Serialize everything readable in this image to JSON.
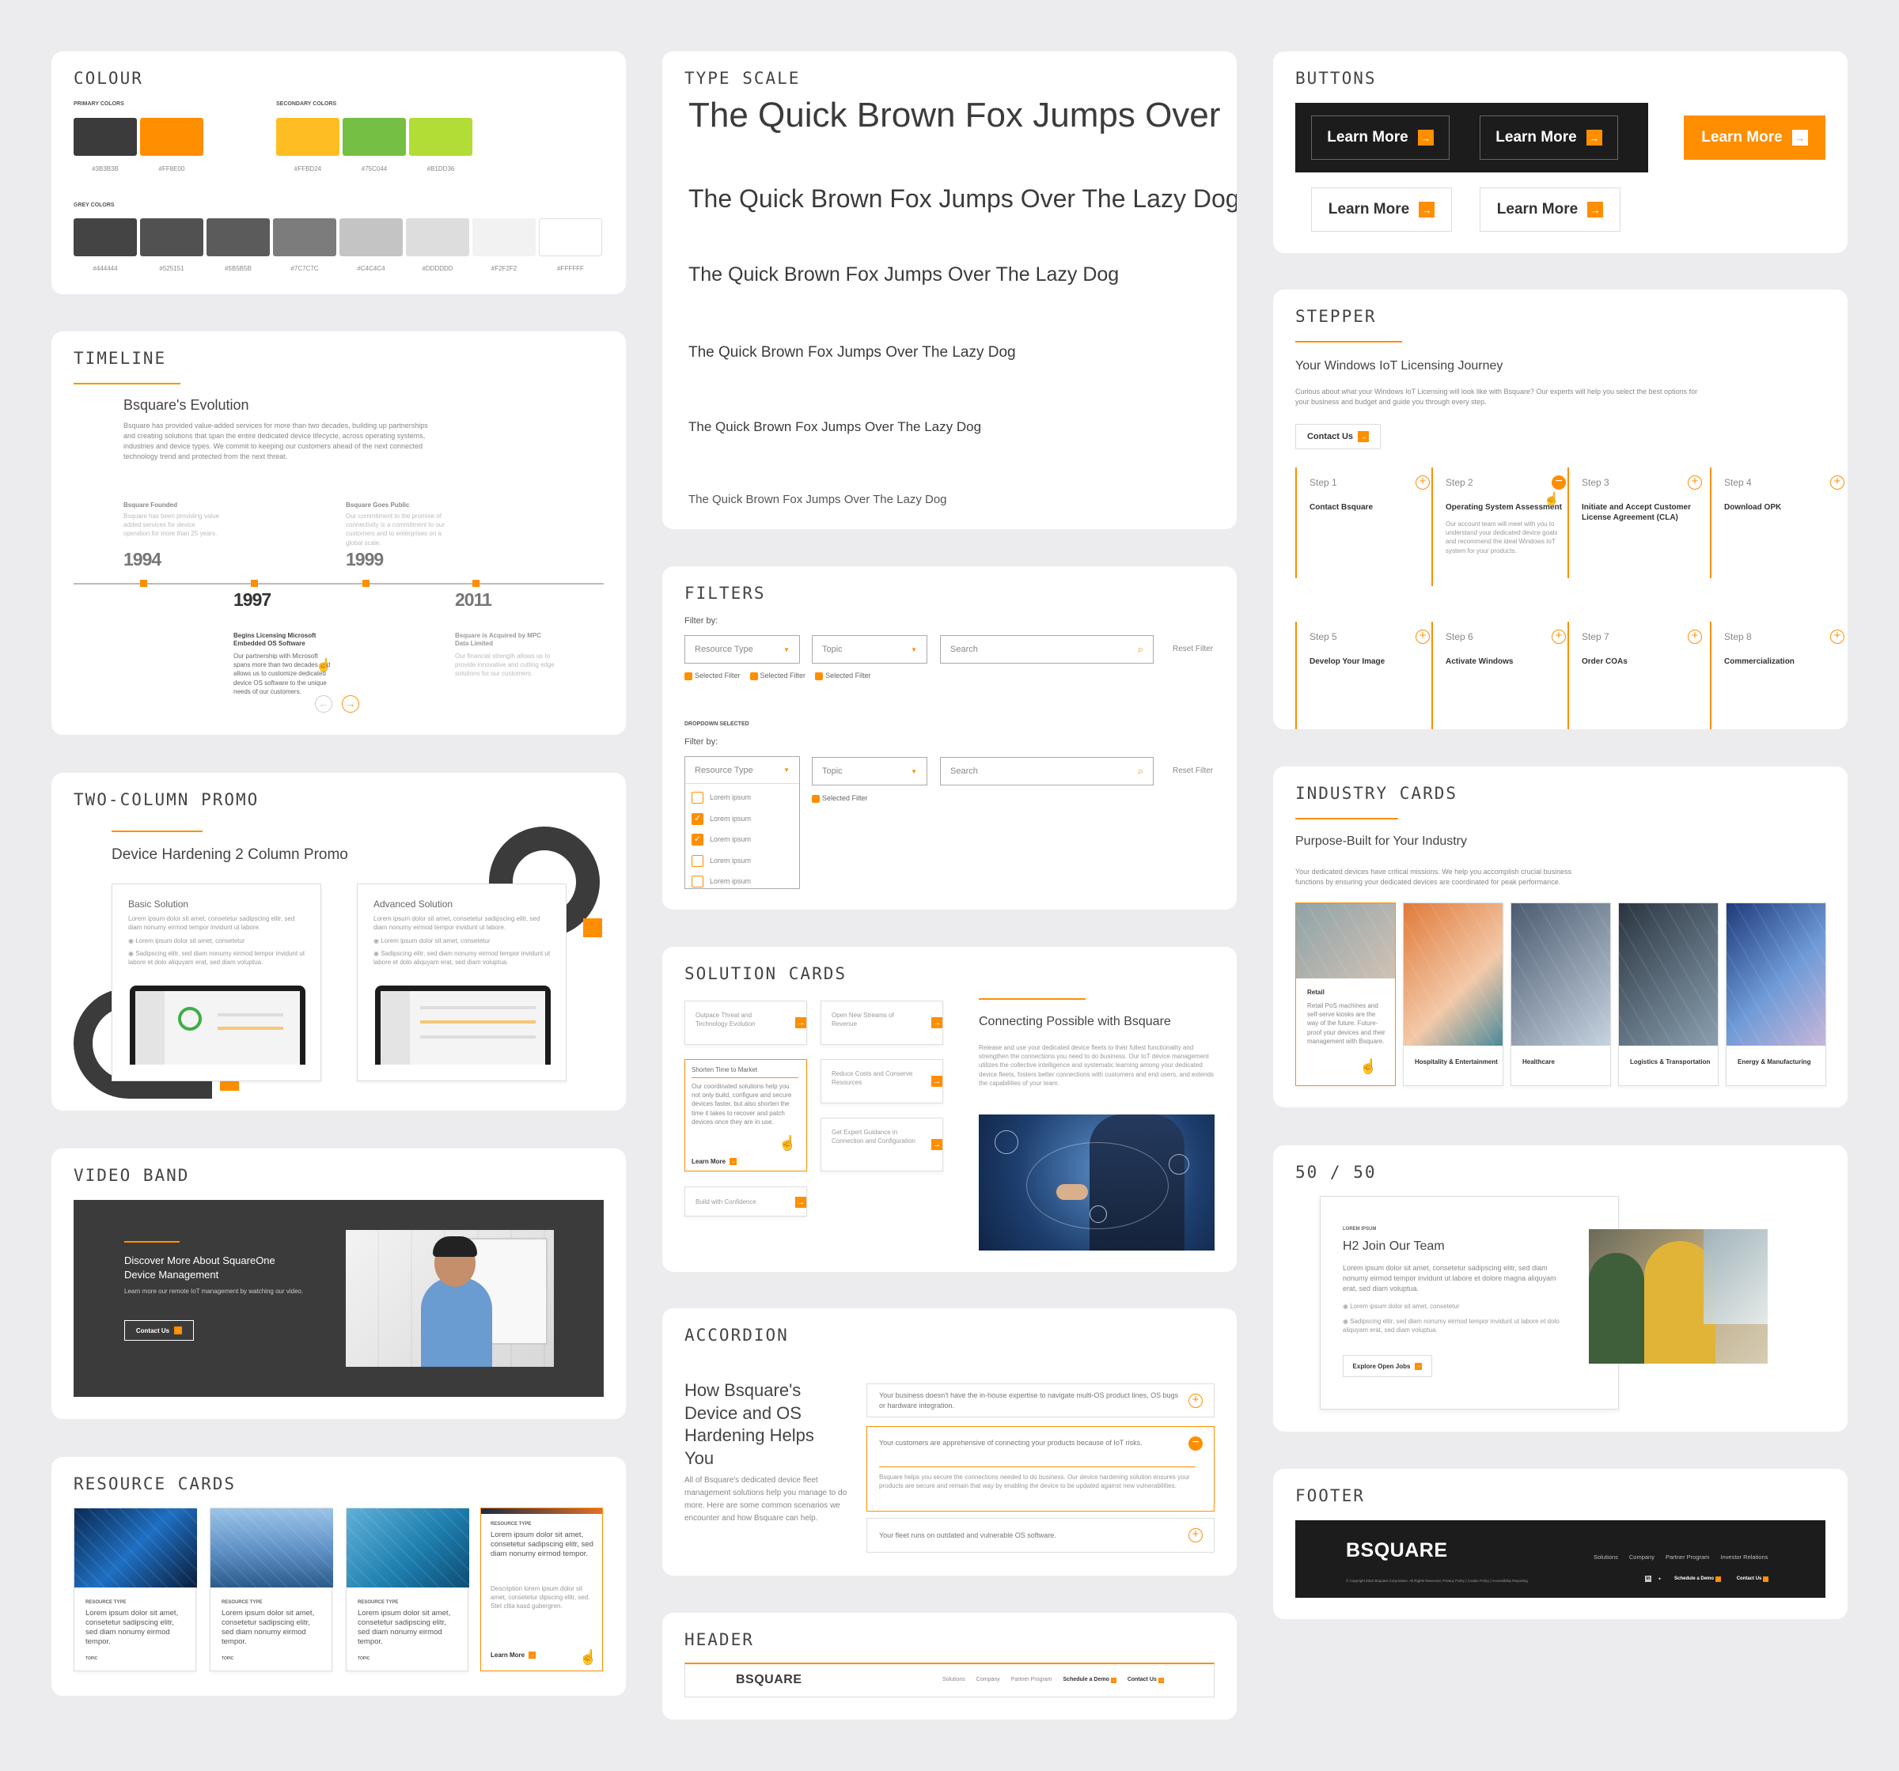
{
  "colour": {
    "title": "COLOUR",
    "primary_label": "PRIMARY COLORS",
    "secondary_label": "SECONDARY COLORS",
    "grey_label": "GREY COLORS",
    "primary": [
      {
        "hex": "#3B3B3B",
        "label": "#3B3B3B"
      },
      {
        "hex": "#FF8E00",
        "label": "#FF8E00"
      }
    ],
    "secondary": [
      {
        "hex": "#FFBD24",
        "label": "#FFBD24"
      },
      {
        "hex": "#75C044",
        "label": "#75C044"
      },
      {
        "hex": "#B1DD36",
        "label": "#B1DD36"
      }
    ],
    "grey": [
      {
        "hex": "#444444",
        "label": "#444444"
      },
      {
        "hex": "#525151",
        "label": "#525151"
      },
      {
        "hex": "#5B5B5B",
        "label": "#5B5B5B"
      },
      {
        "hex": "#7C7C7C",
        "label": "#7C7C7C"
      },
      {
        "hex": "#C4C4C4",
        "label": "#C4C4C4"
      },
      {
        "hex": "#DDDDDD",
        "label": "#DDDDDD"
      },
      {
        "hex": "#F2F2F2",
        "label": "#F2F2F2"
      },
      {
        "hex": "#FFFFFF",
        "label": "#FFFFFF"
      }
    ]
  },
  "timeline": {
    "title": "TIMELINE",
    "heading": "Bsquare's Evolution",
    "intro": "Bsquare has provided value-added services for more than two decades, building up partnerships and creating solutions that span the entire dedicated device lifecycle, across operating systems, industries and device types. We commit to keeping our customers ahead of the next connected technology trend and protected from the next threat.",
    "events": [
      {
        "year": "1994",
        "title": "Bsquare Founded",
        "text": "Bsquare has been providing value added services for device operation for more than 25 years."
      },
      {
        "year": "1997",
        "title": "Begins Licensing Microsoft Embedded OS Software",
        "text": "Our partnership with Microsoft spans more than two decades and allows us to customize dedicated device OS software to the unique needs of our customers."
      },
      {
        "year": "1999",
        "title": "Bsquare Goes Public",
        "text": "Our commitment to the promise of connectivity is a commitment to our customers and to enterprises on a global scale."
      },
      {
        "year": "2011",
        "title": "Bsquare is Acquired by MPC Data Limited",
        "text": "Our financial strength allows us to provide innovative and cutting edge solutions for our customers."
      }
    ]
  },
  "promo": {
    "title": "TWO-COLUMN PROMO",
    "heading": "Device Hardening 2 Column Promo",
    "cols": [
      {
        "name": "Basic Solution",
        "text": "Lorem ipsum dolor sit amet, consetetur sadipscing elitr, sed diam nonumy eirmod tempor invidunt ut labore.",
        "b1": "Lorem ipsum dolor sit amet, consetetur",
        "b2": "Sadipscing elitr, sed diam nonumy eirmod tempor invidunt ut labore et dolo aliquyam erat, sed diam voluptua."
      },
      {
        "name": "Advanced Solution",
        "text": "Lorem ipsum dolor sit amet, consetetur sadipscing elitr, sed diam nonumy eirmod tempor invidunt ut labore.",
        "b1": "Lorem ipsum dolor sit amet, consetetur",
        "b2": "Sadipscing elitr, sed diam nonumy eirmod tempor invidunt ut labore et dolo aliquyam erat, sed diam voluptua."
      }
    ]
  },
  "video": {
    "title": "VIDEO BAND",
    "heading": "Discover More About SquareOne Device Management",
    "text": "Learn more our remote IoT management by watching our video.",
    "cta": "Contact Us"
  },
  "resources": {
    "title": "RESOURCE CARDS",
    "type": "RESOURCE TYPE",
    "text": "Lorem ipsum dolor sit amet, consetetur sadipscing elitr, sed diam nonumy eirmod tempor.",
    "topic": "TOPIC",
    "hover_text": "Lorem ipsum dolor sit amet, consetetur sadipscing elitr, sed diam nonumy eirmod tempor.",
    "hover_desc": "Description lorem ipsum dolor sit amet, consetetur dipscing elitr, sed. Stet clita kasd gubergren.",
    "cta": "Learn More"
  },
  "type": {
    "title": "TYPE SCALE",
    "line1": "The Quick Brown Fox Jumps Over",
    "line": "The Quick Brown Fox Jumps Over The Lazy Dog"
  },
  "filters": {
    "title": "FILTERS",
    "filter_by": "Filter by:",
    "resource_type": "Resource Type",
    "topic": "Topic",
    "search": "Search",
    "reset": "Reset Filter",
    "selected": "Selected Filter",
    "dropdown_selected": "DROPDOWN SELECTED",
    "option": "Lorem ipsum"
  },
  "solutions": {
    "title": "SOLUTION CARDS",
    "left": [
      "Outpace Threat and Technology Evolution",
      "Shorten Time to Market",
      "Build with Confidence"
    ],
    "right": [
      "Open New Streams of Revenue",
      "Reduce Costs and Conserve Resources",
      "Get Expert Guidance in Connection and Configuration"
    ],
    "expanded_text": "Our coordinated solutions help you not only build, configure and secure devices faster, but also shorten the time it takes to recover and patch devices once they are in use.",
    "expanded_cta": "Learn More",
    "heading": "Connecting Possible with Bsquare",
    "text": "Release and use your dedicated device fleets to their fullest functionality and strengthen the connections you need to do business. Our IoT device management utilizes the collective intelligence and systematic learning among your dedicated device fleets, fosters better connections with customers and end users, and extends the capabilities of your team."
  },
  "accordion": {
    "title": "ACCORDION",
    "heading": "How Bsquare's Device and OS Hardening Helps You",
    "text": "All of Bsquare's dedicated device fleet management solutions help you manage to do more. Here are some common scenarios we encounter and how Bsquare can help.",
    "items": [
      "Your business doesn't have the in-house expertise to navigate multi-OS product lines, OS bugs or hardware integration.",
      "Your customers are apprehensive of connecting your products because of IoT risks.",
      "Your fleet runs on outdated and vulnerable OS software."
    ],
    "open_text": "Bsquare helps you secure the connections needed to do business. Our device hardening solution ensures your products are secure and remain that way by enabling the device to be updated against new vulnerabilities."
  },
  "header": {
    "title": "HEADER",
    "logo": "BSQUARE",
    "nav": [
      "Solutions",
      "Company",
      "Partner Program"
    ],
    "demo": "Schedule a Demo",
    "contact": "Contact Us"
  },
  "buttons": {
    "title": "BUTTONS",
    "label": "Learn More"
  },
  "stepper": {
    "title": "STEPPER",
    "heading": "Your Windows IoT Licensing Journey",
    "text": "Curious about what your Windows IoT Licensing will look like with Bsquare? Our experts will help you select the best options for your business and budget and guide you through every step.",
    "cta": "Contact Us",
    "steps": [
      {
        "label": "Step 1",
        "name": "Contact Bsquare"
      },
      {
        "label": "Step 2",
        "name": "Operating System Assessment",
        "desc": "Our account team will meet with you to understand your dedicated device goals and recommend the ideal Windows IoT system for your products."
      },
      {
        "label": "Step 3",
        "name": "Initiate and Accept Customer License Agreement (CLA)"
      },
      {
        "label": "Step 4",
        "name": "Download OPK"
      },
      {
        "label": "Step 5",
        "name": "Develop Your Image"
      },
      {
        "label": "Step 6",
        "name": "Activate Windows"
      },
      {
        "label": "Step 7",
        "name": "Order COAs"
      },
      {
        "label": "Step 8",
        "name": "Commercialization"
      }
    ]
  },
  "industry": {
    "title": "INDUSTRY CARDS",
    "heading": "Purpose-Built for Your Industry",
    "text": "Your dedicated devices have critical missions. We help you accomplish crucial business functions by ensuring your dedicated devices are coordinated for peak performance.",
    "cards": [
      "Retail",
      "Hospitality & Entertainment",
      "Healthcare",
      "Logistics & Transportation",
      "Energy & Manufacturing"
    ],
    "retail_text": "Retail PoS machines and self-serve kiosks are the way of the future. Future-proof your devices and their management with Bsquare."
  },
  "fifty": {
    "title": "50 / 50",
    "eyebrow": "LOREM IPSUM",
    "heading": "H2 Join Our Team",
    "text": "Lorem ipsum dolor sit amet, consetetur sadipscing elitr, sed diam nonumy eirmod tempor invidunt ut labore et dolore magna aliquyam erat, sed diam voluptua.",
    "b1": "Lorem ipsum dolor sit amet, consetetur",
    "b2": "Sadipscing elitr, sed diam nonumy eirmod tempor invidunt ut labore et dolo aliquyam erat, sed diam voluptua.",
    "cta": "Explore Open Jobs"
  },
  "footer": {
    "title": "FOOTER",
    "logo": "BSQUARE",
    "nav": [
      "Solutions",
      "Company",
      "Partner Program",
      "Investor Relations"
    ],
    "copyright": "© Copyright 2022 Bsquare Corporation. All Rights Reserved. Privacy Policy | Cookie Policy | Accessibility Reporting",
    "demo": "Schedule a Demo",
    "contact": "Contact Us"
  }
}
